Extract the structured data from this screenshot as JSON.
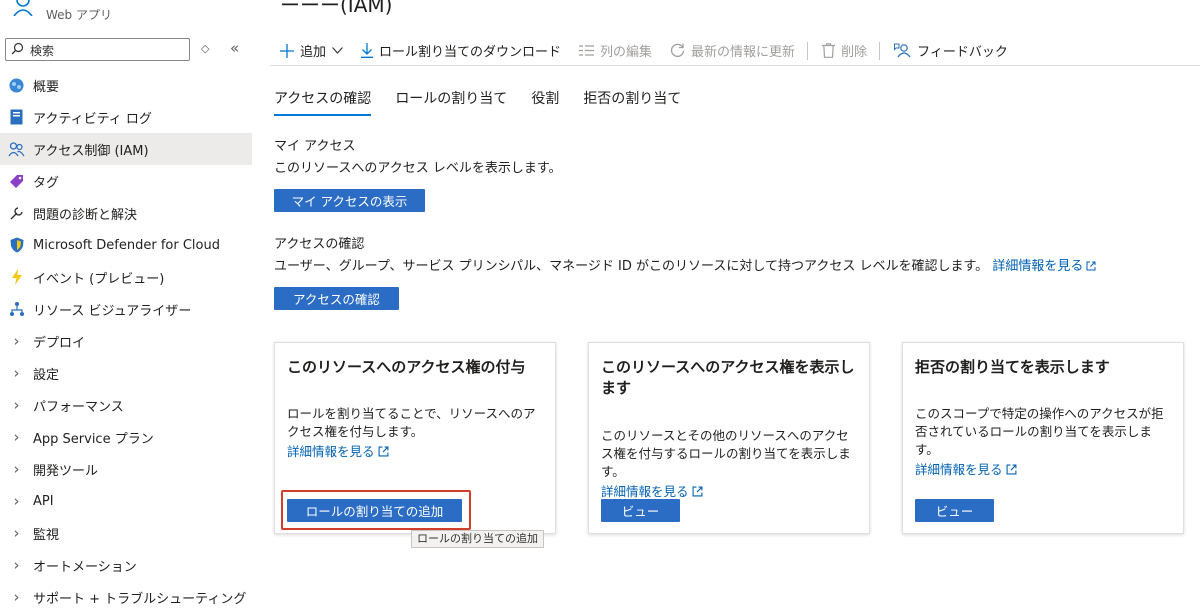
{
  "app": {
    "subtitle": "Web アプリ",
    "page_title_partial": "ーーー(IAM)"
  },
  "search": {
    "placeholder": "検索"
  },
  "sidebar": {
    "items": [
      {
        "label": "概要",
        "icon": "globe-icon"
      },
      {
        "label": "アクティビティ ログ",
        "icon": "log-icon"
      },
      {
        "label": "アクセス制御 (IAM)",
        "icon": "people-icon",
        "active": true
      },
      {
        "label": "タグ",
        "icon": "tag-icon"
      },
      {
        "label": "問題の診断と解決",
        "icon": "wrench-icon"
      },
      {
        "label": "Microsoft Defender for Cloud",
        "icon": "shield-icon"
      },
      {
        "label": "イベント (プレビュー)",
        "icon": "lightning-icon"
      },
      {
        "label": "リソース ビジュアライザー",
        "icon": "network-icon"
      },
      {
        "label": "デプロイ",
        "group": true
      },
      {
        "label": "設定",
        "group": true
      },
      {
        "label": "パフォーマンス",
        "group": true
      },
      {
        "label": "App Service プラン",
        "group": true
      },
      {
        "label": "開発ツール",
        "group": true
      },
      {
        "label": "API",
        "group": true
      },
      {
        "label": "監視",
        "group": true
      },
      {
        "label": "オートメーション",
        "group": true
      },
      {
        "label": "サポート + トラブルシューティング",
        "group": true
      }
    ]
  },
  "toolbar": {
    "add": "追加",
    "download": "ロール割り当てのダウンロード",
    "edit_columns": "列の編集",
    "refresh": "最新の情報に更新",
    "delete": "削除",
    "feedback": "フィードバック"
  },
  "tabs": [
    "アクセスの確認",
    "ロールの割り当て",
    "役割",
    "拒否の割り当て"
  ],
  "my_access": {
    "title": "マイ アクセス",
    "desc": "このリソースへのアクセス レベルを表示します。",
    "button": "マイ アクセスの表示"
  },
  "check_access": {
    "title": "アクセスの確認",
    "desc": "ユーザー、グループ、サービス プリンシパル、マネージド ID がこのリソースに対して持つアクセス レベルを確認します。",
    "link": "詳細情報を見る",
    "button": "アクセスの確認"
  },
  "cards": [
    {
      "title": "このリソースへのアクセス権の付与",
      "body": "ロールを割り当てることで、リソースへのアクセス権を付与します。",
      "link": "詳細情報を見る",
      "button": "ロールの割り当ての追加"
    },
    {
      "title": "このリソースへのアクセス権を表示します",
      "body": "このリソースとその他のリソースへのアクセス権を付与するロールの割り当てを表示します。",
      "link": "詳細情報を見る",
      "button": "ビュー"
    },
    {
      "title": "拒否の割り当てを表示します",
      "body": "このスコープで特定の操作へのアクセスが拒否されているロールの割り当てを表示します。",
      "link": "詳細情報を見る",
      "button": "ビュー"
    }
  ],
  "tooltip": "ロールの割り当ての追加",
  "colors": {
    "primary": "#2b6cc4",
    "link": "#0062b3",
    "highlight": "#d13e2c",
    "active_bg": "#edebe9"
  }
}
